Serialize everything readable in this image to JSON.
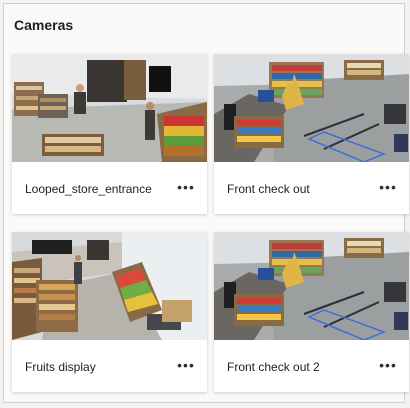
{
  "header": {
    "title": "Cameras"
  },
  "cameras": [
    {
      "name": "Looped_store_entrance",
      "more_icon": "more-horizontal-icon"
    },
    {
      "name": "Front check out",
      "more_icon": "more-horizontal-icon"
    },
    {
      "name": "Fruits display",
      "more_icon": "more-horizontal-icon"
    },
    {
      "name": "Front check out 2",
      "more_icon": "more-horizontal-icon"
    }
  ]
}
